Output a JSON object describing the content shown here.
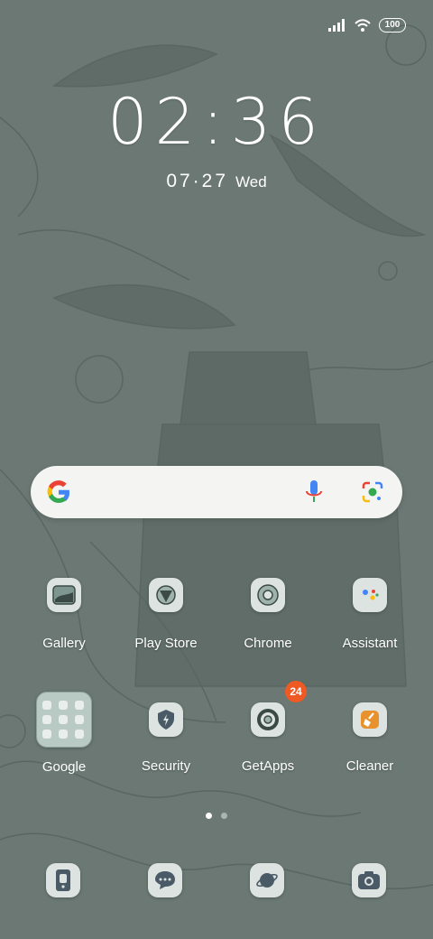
{
  "status_bar": {
    "battery": "100",
    "signal_icon": "signal-bars-icon",
    "wifi_icon": "wifi-icon"
  },
  "clock": {
    "time": "02:36",
    "date": "07·27",
    "weekday": "Wed"
  },
  "search_bar": {
    "logo": "google-g-icon",
    "mic": "mic-icon",
    "lens": "lens-camera-icon"
  },
  "apps_row1": [
    {
      "label": "Gallery",
      "icon": "gallery-icon"
    },
    {
      "label": "Play Store",
      "icon": "play-store-icon"
    },
    {
      "label": "Chrome",
      "icon": "chrome-icon"
    },
    {
      "label": "Assistant",
      "icon": "assistant-icon"
    }
  ],
  "apps_row2": [
    {
      "label": "Google",
      "icon": "folder-icon"
    },
    {
      "label": "Security",
      "icon": "security-shield-icon"
    },
    {
      "label": "GetApps",
      "icon": "getapps-icon",
      "badge": "24"
    },
    {
      "label": "Cleaner",
      "icon": "cleaner-broom-icon"
    }
  ],
  "page_indicator": {
    "pages": 2,
    "active": 1
  },
  "dock": [
    {
      "icon": "phone-icon"
    },
    {
      "icon": "messages-icon"
    },
    {
      "icon": "browser-planet-icon"
    },
    {
      "icon": "camera-icon"
    }
  ],
  "colors": {
    "wallpaper": "#6b7874",
    "badge": "#ef5a24",
    "cleaner": "#e8922e"
  }
}
